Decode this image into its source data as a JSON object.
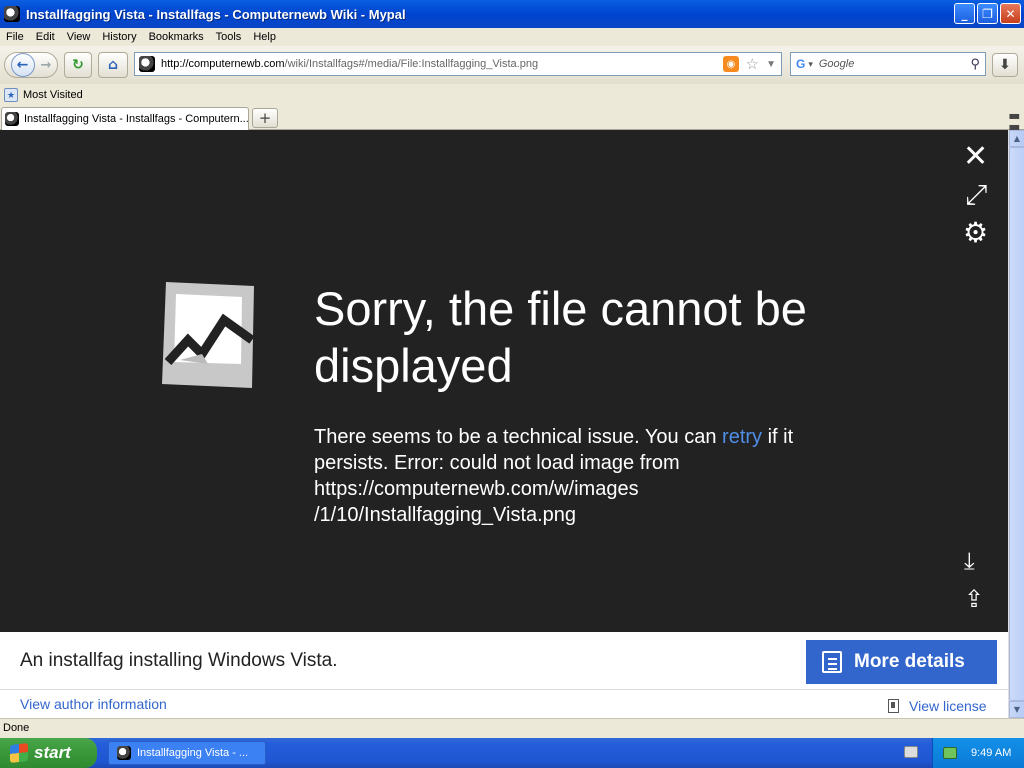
{
  "window": {
    "title": "Installfagging Vista - Installfags - Computernewb Wiki - Mypal"
  },
  "menu": [
    "File",
    "Edit",
    "View",
    "History",
    "Bookmarks",
    "Tools",
    "Help"
  ],
  "navbar": {
    "url_domain": "http://computernewb.com",
    "url_path": "/wiki/Installfags#/media/File:Installfagging_Vista.png",
    "search_placeholder": "Google",
    "search_engine_glyph": "G"
  },
  "bookmarks": {
    "most_visited": "Most Visited"
  },
  "tabs": [
    {
      "label": "Installfagging Vista - Installfags - Computern..."
    }
  ],
  "viewer": {
    "error_title": "Sorry, the file cannot be displayed",
    "error_before": "There seems to be a technical issue. You can ",
    "retry_label": "retry",
    "error_after": " if it persists. Error: could not load image from https://computernewb.com/w/images /1/10/Installfagging_Vista.png",
    "caption": "An installfag installing Windows Vista.",
    "more_details": "More details",
    "author_link": "View author information",
    "license_link": "View license"
  },
  "statusbar": {
    "text": "Done"
  },
  "taskbar": {
    "start": "start",
    "task_label": "Installfagging Vista - ...",
    "clock": "9:49 AM"
  },
  "colors": {
    "viewer_bg": "#222222",
    "accent": "#3366cc",
    "link": "#4f8fe8"
  }
}
